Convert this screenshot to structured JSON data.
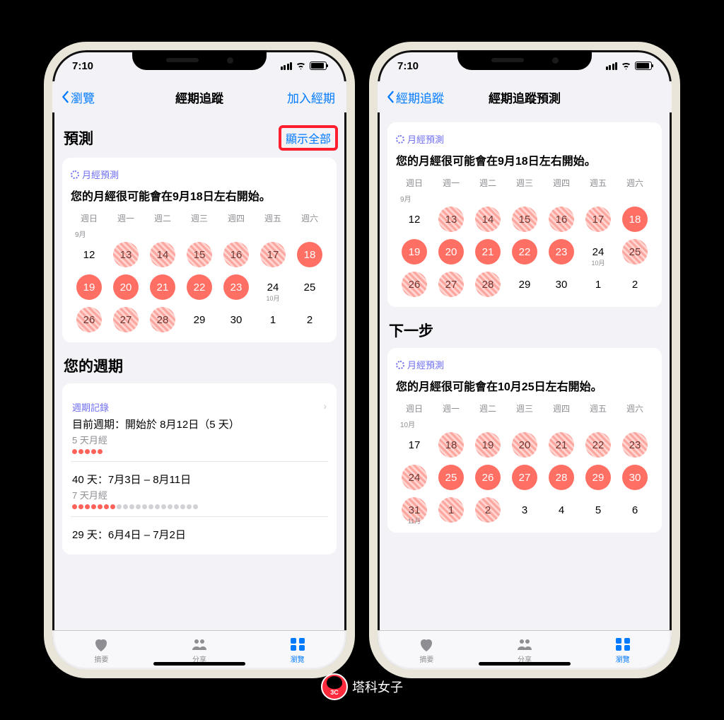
{
  "status": {
    "time": "7:10"
  },
  "left": {
    "nav": {
      "back": "瀏覽",
      "title": "經期追蹤",
      "right": "加入經期"
    },
    "section1": {
      "heading": "預測",
      "show_all": "顯示全部"
    },
    "card1": {
      "label": "月經預測",
      "title": "您的月經很可能會在9月18日左右開始。",
      "dow": [
        "週日",
        "週一",
        "週二",
        "週三",
        "週四",
        "週五",
        "週六"
      ],
      "month1": "9月",
      "month2": "10月",
      "rows": [
        [
          {
            "n": "12"
          },
          {
            "n": "13",
            "c": "pred"
          },
          {
            "n": "14",
            "c": "pred"
          },
          {
            "n": "15",
            "c": "pred"
          },
          {
            "n": "16",
            "c": "pred"
          },
          {
            "n": "17",
            "c": "pred"
          },
          {
            "n": "18",
            "c": "solid"
          }
        ],
        [
          {
            "n": "19",
            "c": "solid"
          },
          {
            "n": "20",
            "c": "solid"
          },
          {
            "n": "21",
            "c": "solid"
          },
          {
            "n": "22",
            "c": "solid"
          },
          {
            "n": "23",
            "c": "solid"
          },
          {
            "n": "24",
            "sub": "10月"
          },
          {
            "n": "25"
          }
        ],
        [
          {
            "n": "26",
            "c": "pred"
          },
          {
            "n": "27",
            "c": "pred"
          },
          {
            "n": "28",
            "c": "pred"
          },
          {
            "n": "29"
          },
          {
            "n": "30"
          },
          {
            "n": "1"
          },
          {
            "n": "2"
          }
        ]
      ]
    },
    "section2": {
      "heading": "您的週期"
    },
    "cycle_card": {
      "label": "週期記錄",
      "r1_title": "目前週期：開始於 8月12日（5 天）",
      "r1_sub": "5 天月經",
      "r1_dots_on": 5,
      "r1_dots_total": 5,
      "r2_title": "40 天：7月3日 – 8月11日",
      "r2_sub": "7 天月經",
      "r2_dots_on": 7,
      "r2_dots_total": 20,
      "r3_title": "29 天：6月4日 – 7月2日"
    }
  },
  "right": {
    "nav": {
      "back": "經期追蹤",
      "title": "經期追蹤預測"
    },
    "card1": {
      "label": "月經預測",
      "title": "您的月經很可能會在9月18日左右開始。",
      "dow": [
        "週日",
        "週一",
        "週二",
        "週三",
        "週四",
        "週五",
        "週六"
      ],
      "month1": "9月",
      "rows": [
        [
          {
            "n": "12"
          },
          {
            "n": "13",
            "c": "pred"
          },
          {
            "n": "14",
            "c": "pred"
          },
          {
            "n": "15",
            "c": "pred"
          },
          {
            "n": "16",
            "c": "pred"
          },
          {
            "n": "17",
            "c": "pred"
          },
          {
            "n": "18",
            "c": "solid"
          }
        ],
        [
          {
            "n": "19",
            "c": "solid"
          },
          {
            "n": "20",
            "c": "solid"
          },
          {
            "n": "21",
            "c": "solid"
          },
          {
            "n": "22",
            "c": "solid"
          },
          {
            "n": "23",
            "c": "solid"
          },
          {
            "n": "24",
            "sub": "10月"
          },
          {
            "n": "25",
            "c": "pred"
          }
        ],
        [
          {
            "n": "26",
            "c": "pred"
          },
          {
            "n": "27",
            "c": "pred"
          },
          {
            "n": "28",
            "c": "pred"
          },
          {
            "n": "29"
          },
          {
            "n": "30"
          },
          {
            "n": "1"
          },
          {
            "n": "2"
          }
        ]
      ]
    },
    "section2": {
      "heading": "下一步"
    },
    "card2": {
      "label": "月經預測",
      "title": "您的月經很可能會在10月25日左右開始。",
      "dow": [
        "週日",
        "週一",
        "週二",
        "週三",
        "週四",
        "週五",
        "週六"
      ],
      "month1": "10月",
      "rows": [
        [
          {
            "n": "17"
          },
          {
            "n": "18",
            "c": "pred"
          },
          {
            "n": "19",
            "c": "pred"
          },
          {
            "n": "20",
            "c": "pred"
          },
          {
            "n": "21",
            "c": "pred"
          },
          {
            "n": "22",
            "c": "pred"
          },
          {
            "n": "23",
            "c": "pred"
          }
        ],
        [
          {
            "n": "24",
            "c": "pred"
          },
          {
            "n": "25",
            "c": "solid"
          },
          {
            "n": "26",
            "c": "solid"
          },
          {
            "n": "27",
            "c": "solid"
          },
          {
            "n": "28",
            "c": "solid"
          },
          {
            "n": "29",
            "c": "solid"
          },
          {
            "n": "30",
            "c": "solid"
          }
        ],
        [
          {
            "n": "31",
            "c": "pred",
            "sub": "11月"
          },
          {
            "n": "1",
            "c": "pred"
          },
          {
            "n": "2",
            "c": "pred"
          },
          {
            "n": "3"
          },
          {
            "n": "4"
          },
          {
            "n": "5"
          },
          {
            "n": "6"
          }
        ]
      ]
    }
  },
  "tabs": {
    "summary": "摘要",
    "sharing": "分享",
    "browse": "瀏覽"
  },
  "watermark": "塔科女子"
}
